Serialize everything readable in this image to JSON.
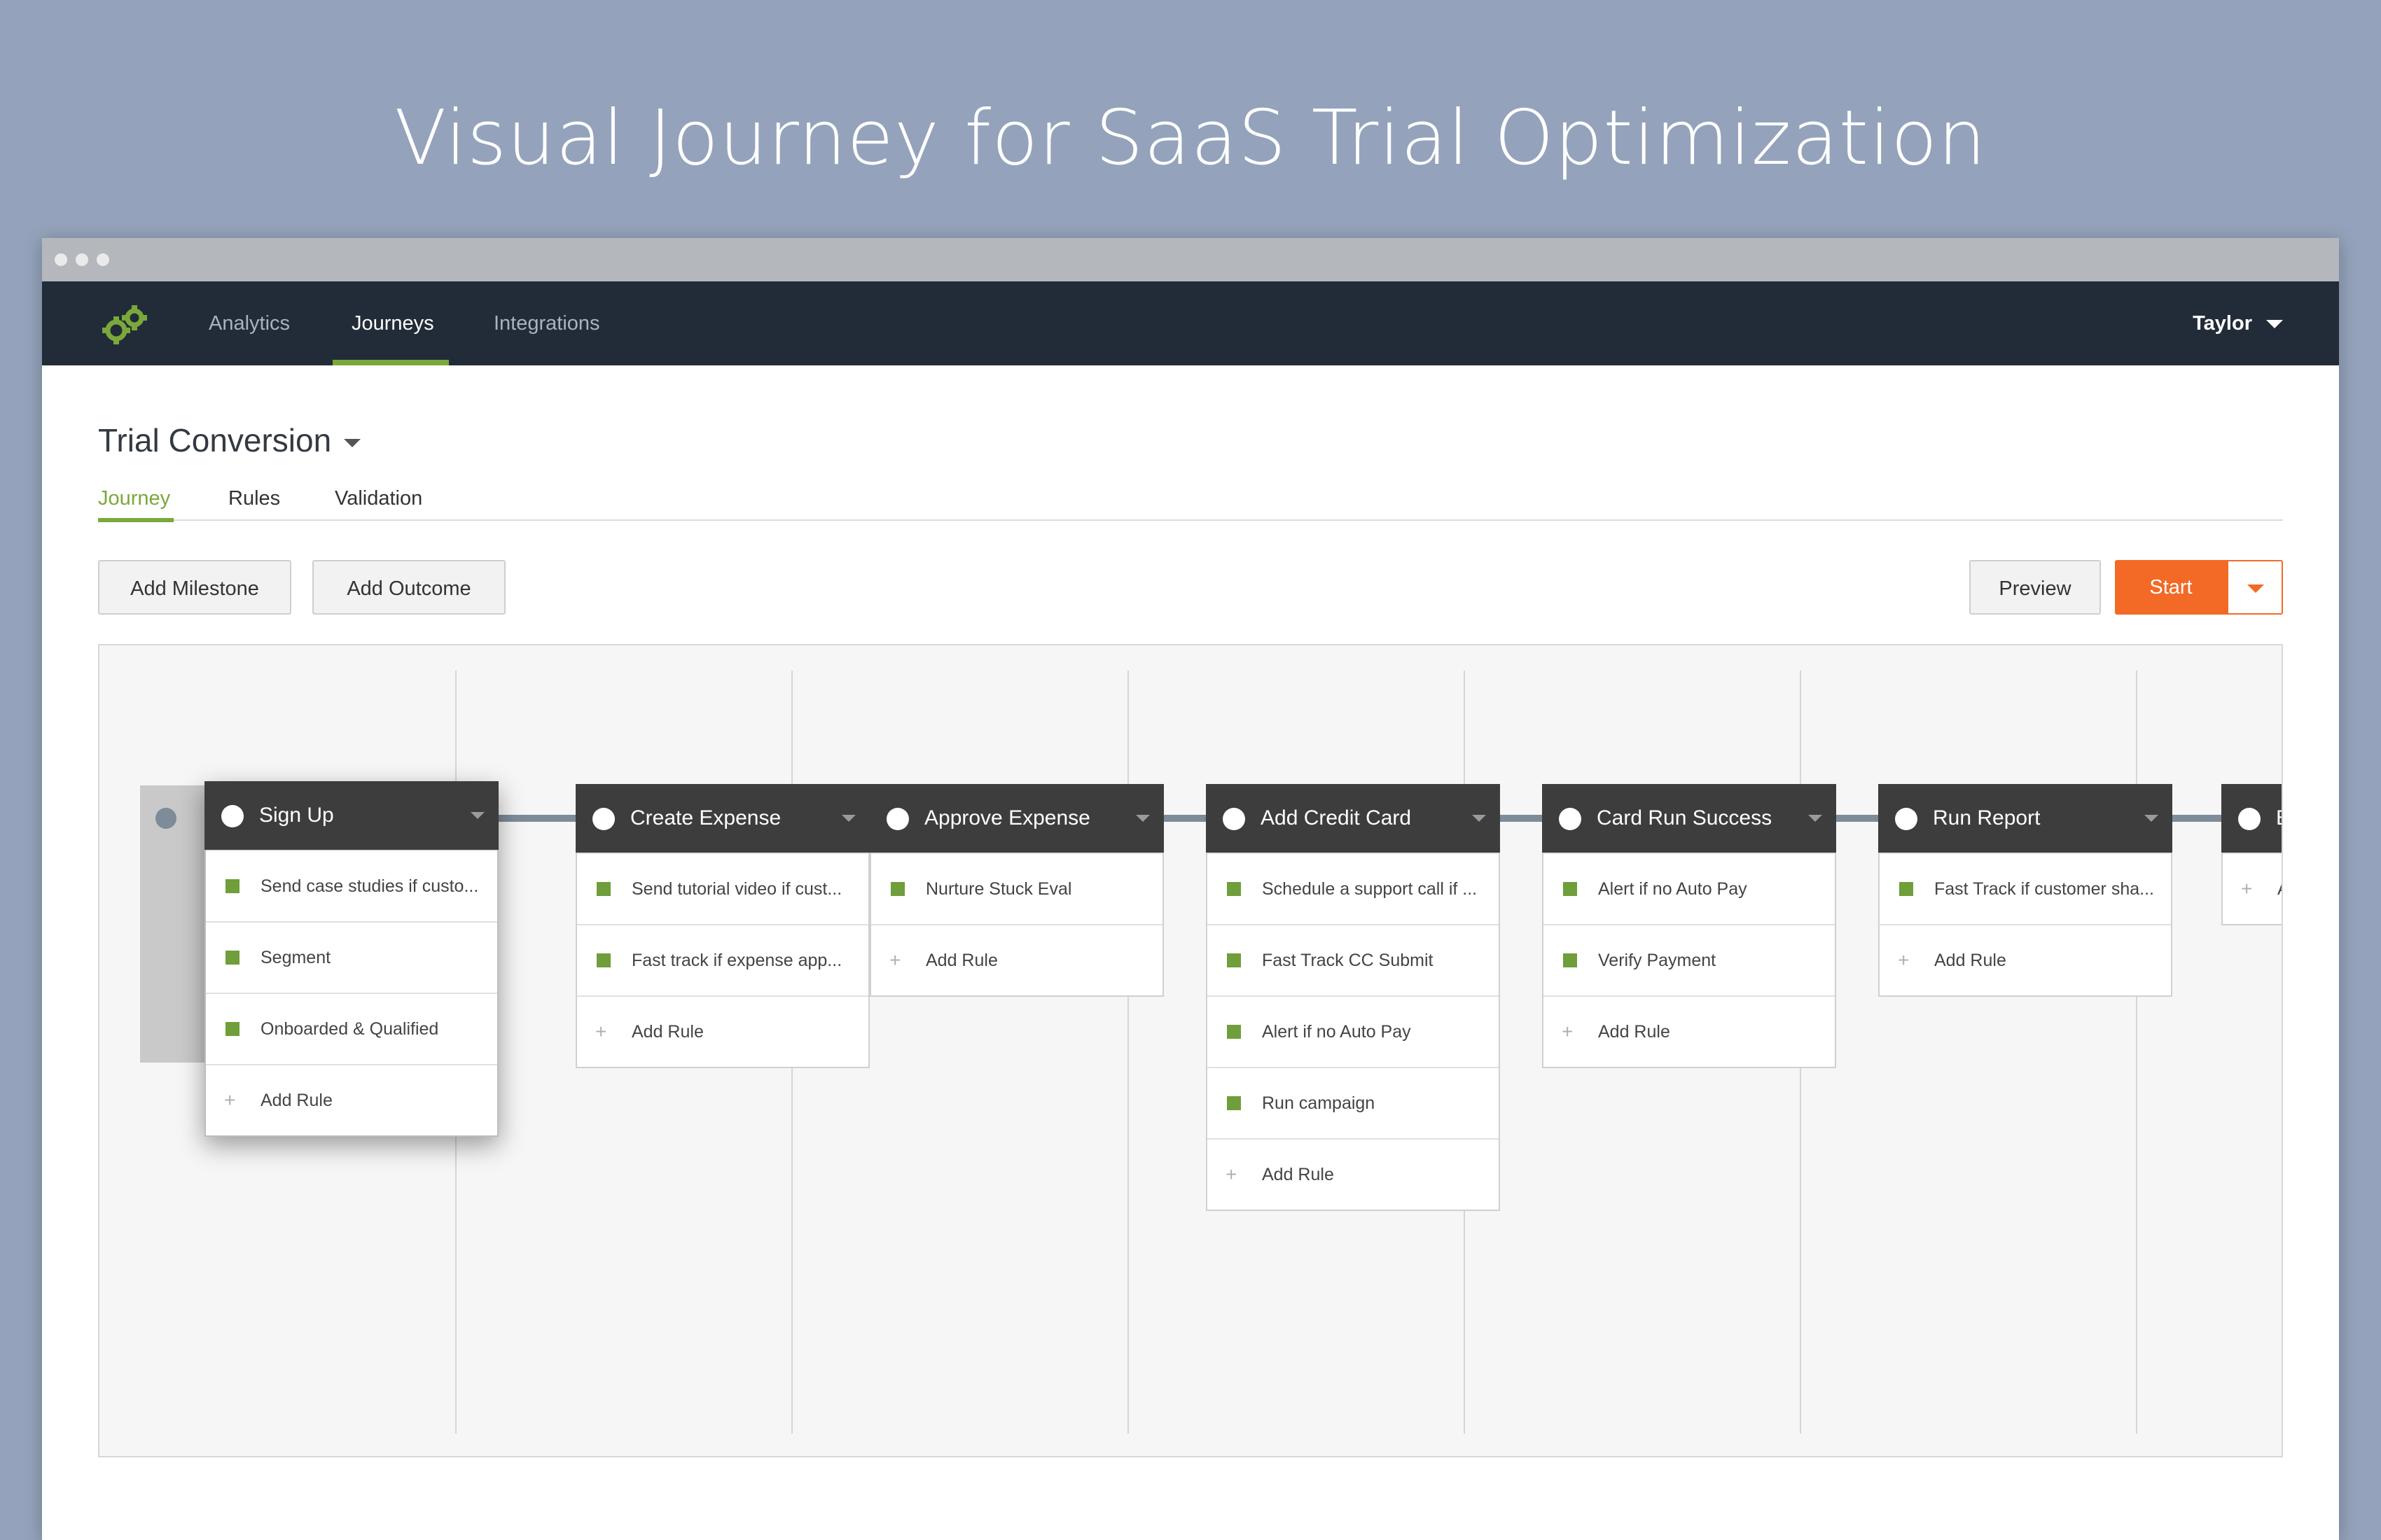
{
  "hero": {
    "title": "Visual Journey for SaaS Trial Optimization"
  },
  "nav": {
    "logo": "gears-logo-icon",
    "items": [
      {
        "label": "Analytics",
        "active": false
      },
      {
        "label": "Journeys",
        "active": true
      },
      {
        "label": "Integrations",
        "active": false
      }
    ],
    "user": "Taylor"
  },
  "page": {
    "title": "Trial Conversion",
    "tabs": [
      {
        "label": "Journey",
        "active": true
      },
      {
        "label": "Rules",
        "active": false
      },
      {
        "label": "Validation",
        "active": false
      }
    ]
  },
  "toolbar": {
    "add_milestone": "Add Milestone",
    "add_outcome": "Add Outcome",
    "preview": "Preview",
    "start": "Start"
  },
  "colors": {
    "accent_green": "#7aa83b",
    "start_orange": "#f26a26",
    "navbar": "#222c38",
    "card_header": "#3d3d3d",
    "connector": "#7e8b99"
  },
  "milestones": [
    {
      "title": "Sign Up",
      "rules": [
        "Send case studies if custo...",
        "Segment",
        "Onboarded & Qualified"
      ],
      "add_rule": "Add Rule"
    },
    {
      "title": "Create Expense",
      "rules": [
        "Send tutorial video if cust...",
        "Fast track if expense app..."
      ],
      "add_rule": "Add Rule"
    },
    {
      "title": "Approve Expense",
      "rules": [
        "Nurture Stuck Eval"
      ],
      "add_rule": "Add Rule"
    },
    {
      "title": "Add Credit Card",
      "rules": [
        "Schedule a support call if ...",
        "Fast Track CC Submit",
        "Alert if no Auto Pay",
        "Run campaign"
      ],
      "add_rule": "Add Rule"
    },
    {
      "title": "Card Run Success",
      "rules": [
        "Alert if no Auto Pay",
        "Verify Payment"
      ],
      "add_rule": "Add Rule"
    },
    {
      "title": "Run Report",
      "rules": [
        "Fast Track if customer sha..."
      ],
      "add_rule": "Add Rule"
    },
    {
      "title": "Billing",
      "rules": [],
      "add_rule": "Add Rule"
    }
  ]
}
